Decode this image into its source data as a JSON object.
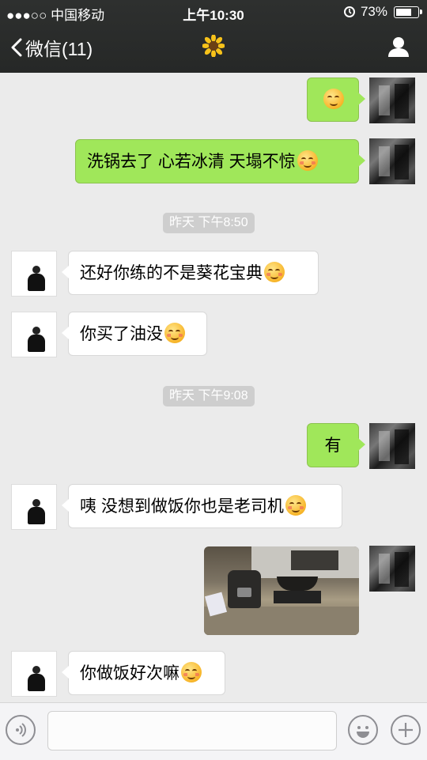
{
  "status_bar": {
    "carrier": "●●●○○ 中国移动",
    "time": "上午10:30",
    "battery_percent": "73%",
    "battery_level": 0.73
  },
  "nav": {
    "back_label": "微信(11)",
    "title_icon": "sunflower-icon",
    "profile_icon": "person-icon"
  },
  "messages": [
    {
      "side": "sent",
      "text": ""
    },
    {
      "side": "sent",
      "text": "洗锅去了  心若冰清 天塌不惊"
    },
    {
      "side": "timestamp",
      "text": "昨天 下午8:50"
    },
    {
      "side": "recv",
      "text": "还好你练的不是葵花宝典"
    },
    {
      "side": "recv",
      "text": "你买了油没"
    },
    {
      "side": "timestamp",
      "text": "昨天 下午9:08"
    },
    {
      "side": "sent",
      "text": "有"
    },
    {
      "side": "recv",
      "text": "咦 没想到做饭你也是老司机"
    },
    {
      "side": "sent",
      "type": "photo",
      "text": ""
    },
    {
      "side": "recv",
      "text": "你做饭好次嘛"
    }
  ],
  "input_bar": {
    "voice_icon": "voice-icon",
    "emoji_icon": "emoji-icon",
    "plus_icon": "plus-icon"
  },
  "colors": {
    "sent_bubble": "#a0e75a",
    "header": "#2e302f",
    "chat_bg": "#ebebeb"
  }
}
